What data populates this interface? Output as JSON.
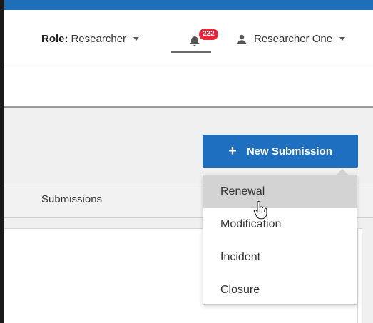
{
  "header": {
    "role_label": "Role:",
    "role_value": "Researcher",
    "notification_count": "222",
    "user_name": "Researcher One"
  },
  "actions": {
    "new_submission_label": "New Submission"
  },
  "tabs": [
    {
      "label": "Submissions"
    }
  ],
  "new_submission_menu": {
    "items": [
      {
        "label": "Renewal",
        "hovered": true
      },
      {
        "label": "Modification"
      },
      {
        "label": "Incident"
      },
      {
        "label": "Closure"
      }
    ]
  },
  "colors": {
    "top_bar": "#1e6fb8",
    "primary_button": "#1f6fc0",
    "badge": "#e8263a",
    "hover_item": "#d3d3d3"
  }
}
